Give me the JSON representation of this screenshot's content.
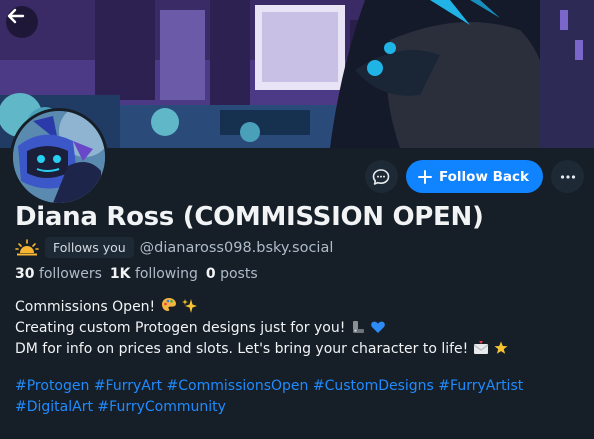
{
  "profile": {
    "display_name": "Diana Ross (COMMISSION OPEN)",
    "follows_you_label": "Follows you",
    "handle": "@dianaross098.bsky.social",
    "stats": {
      "followers_count": "30",
      "followers_label": "followers",
      "following_count": "1K",
      "following_label": "following",
      "posts_count": "0",
      "posts_label": "posts"
    }
  },
  "actions": {
    "message_icon": "chat-bubble-icon",
    "follow_back_label": "Follow Back",
    "more_icon": "ellipsis-icon"
  },
  "bio": {
    "line1": "Commissions Open!",
    "line2": "Creating custom Protogen designs just for you!",
    "line3": "DM for info on prices and slots. Let's bring your character to life!"
  },
  "hashtags": [
    "#Protogen",
    "#FurryArt",
    "#CommissionsOpen",
    "#CustomDesigns",
    "#FurryArtist",
    "#DigitalArt",
    "#FurryCommunity"
  ],
  "colors": {
    "background": "#161e27",
    "accent": "#1083fe",
    "link": "#208bfe",
    "muted_text": "#aebbc9"
  }
}
